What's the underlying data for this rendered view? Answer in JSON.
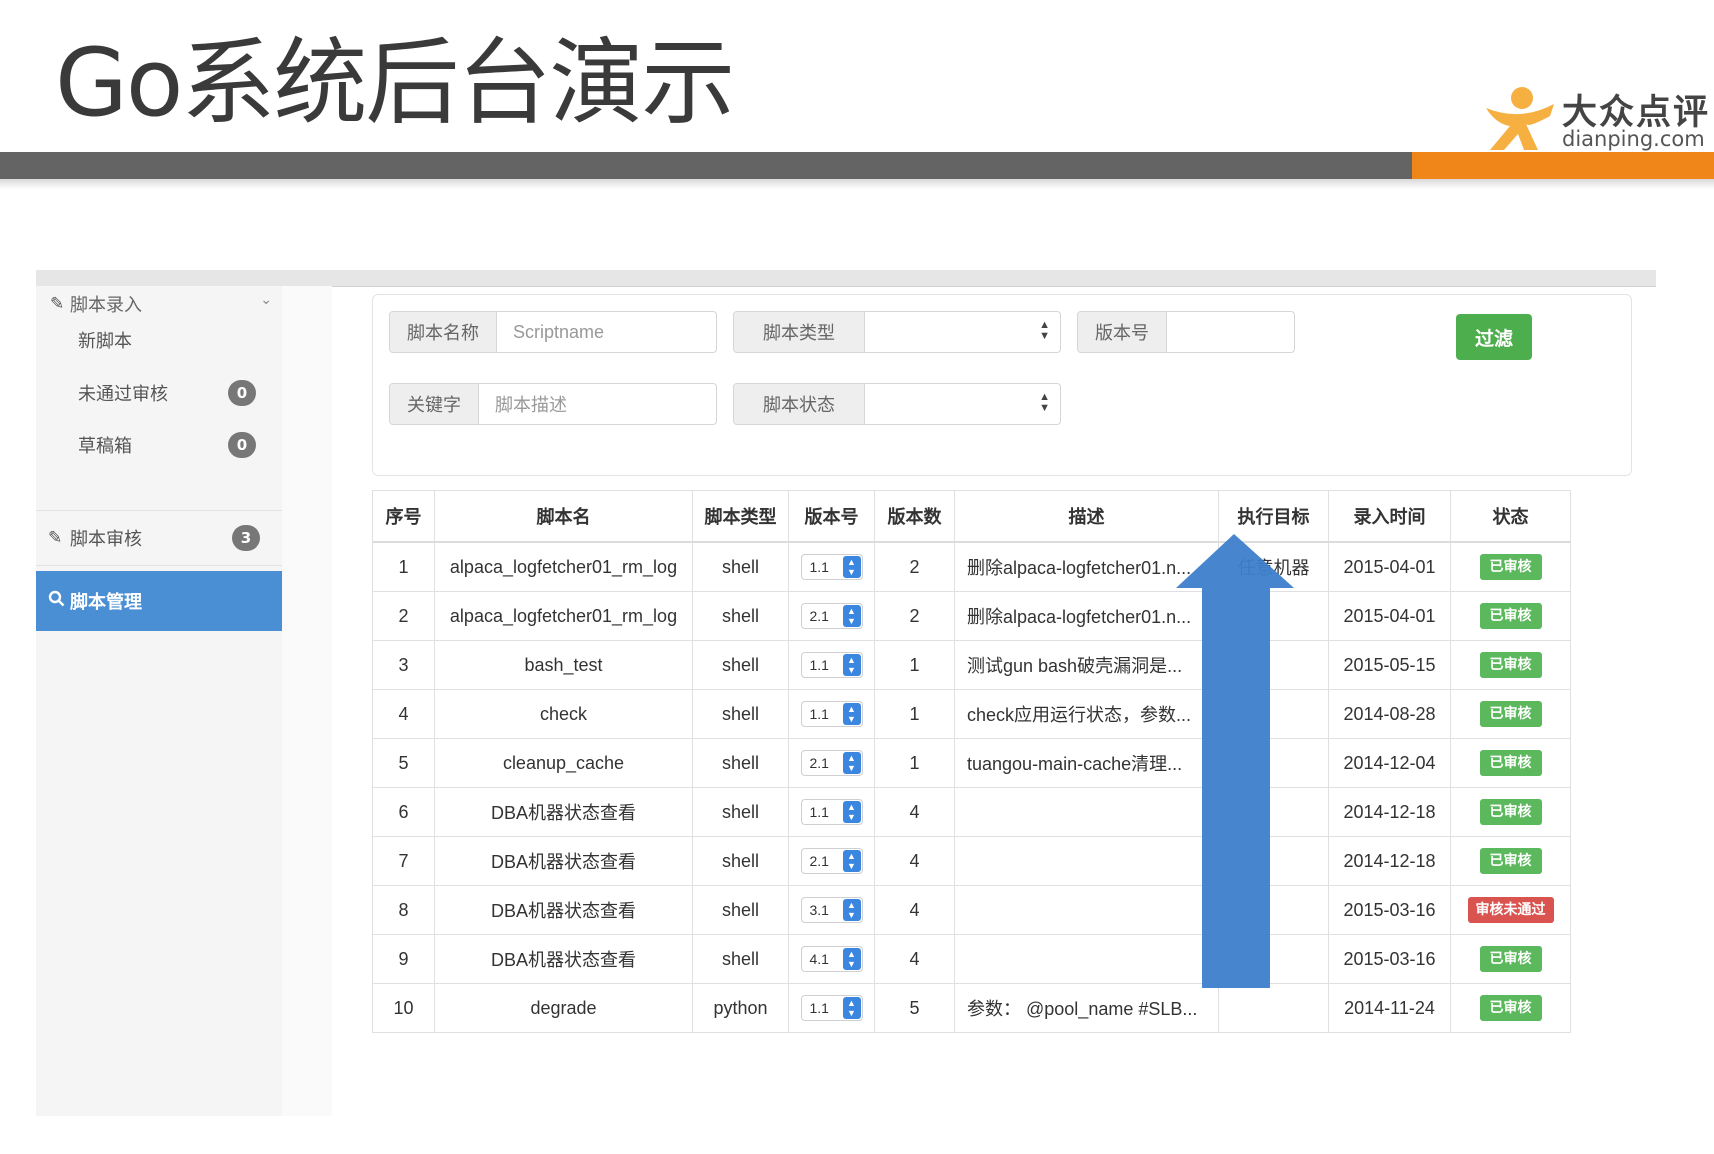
{
  "slide": {
    "title": "Go系统后台演示"
  },
  "logo": {
    "name_cn": "大众点评",
    "name_en": "dianping.com"
  },
  "sidebar": {
    "group": {
      "label": "脚本录入"
    },
    "sub_items": [
      {
        "label": "新脚本",
        "badge": ""
      },
      {
        "label": "未通过审核",
        "badge": "0"
      },
      {
        "label": "草稿箱",
        "badge": "0"
      }
    ],
    "review": {
      "label": "脚本审核",
      "badge": "3"
    },
    "manage": {
      "label": "脚本管理"
    }
  },
  "filters": {
    "script_name": {
      "label": "脚本名称",
      "placeholder": "Scriptname"
    },
    "script_type": {
      "label": "脚本类型",
      "value": ""
    },
    "version": {
      "label": "版本号",
      "value": ""
    },
    "keyword": {
      "label": "关键字",
      "placeholder": "脚本描述"
    },
    "script_status": {
      "label": "脚本状态",
      "value": ""
    },
    "filter_button": "过滤"
  },
  "table": {
    "headers": [
      "序号",
      "脚本名",
      "脚本类型",
      "版本号",
      "版本数",
      "描述",
      "执行目标",
      "录入时间",
      "状态"
    ],
    "rows": [
      {
        "id": "1",
        "name": "alpaca_logfetcher01_rm_log",
        "type": "shell",
        "version": "1.1",
        "count": "2",
        "desc": "删除alpaca-logfetcher01.n...",
        "target": "任意机器",
        "date": "2015-04-01",
        "status": "已审核"
      },
      {
        "id": "2",
        "name": "alpaca_logfetcher01_rm_log",
        "type": "shell",
        "version": "2.1",
        "count": "2",
        "desc": "删除alpaca-logfetcher01.n...",
        "target": "",
        "date": "2015-04-01",
        "status": "已审核"
      },
      {
        "id": "3",
        "name": "bash_test",
        "type": "shell",
        "version": "1.1",
        "count": "1",
        "desc": " 测试gun bash破壳漏洞是...",
        "target": "",
        "date": "2015-05-15",
        "status": "已审核"
      },
      {
        "id": "4",
        "name": "check",
        "type": "shell",
        "version": "1.1",
        "count": "1",
        "desc": "check应用运行状态，参数...",
        "target": "",
        "date": "2014-08-28",
        "status": "已审核"
      },
      {
        "id": "5",
        "name": "cleanup_cache",
        "type": "shell",
        "version": "2.1",
        "count": "1",
        "desc": " tuangou-main-cache清理...",
        "target": "",
        "date": "2014-12-04",
        "status": "已审核"
      },
      {
        "id": "6",
        "name": "DBA机器状态查看",
        "type": "shell",
        "version": "1.1",
        "count": "4",
        "desc": "",
        "target": "",
        "date": "2014-12-18",
        "status": "已审核"
      },
      {
        "id": "7",
        "name": "DBA机器状态查看",
        "type": "shell",
        "version": "2.1",
        "count": "4",
        "desc": "",
        "target": "",
        "date": "2014-12-18",
        "status": "已审核"
      },
      {
        "id": "8",
        "name": "DBA机器状态查看",
        "type": "shell",
        "version": "3.1",
        "count": "4",
        "desc": "",
        "target": "",
        "date": "2015-03-16",
        "status": "审核未通过"
      },
      {
        "id": "9",
        "name": "DBA机器状态查看",
        "type": "shell",
        "version": "4.1",
        "count": "4",
        "desc": "",
        "target": "",
        "date": "2015-03-16",
        "status": "已审核"
      },
      {
        "id": "10",
        "name": "degrade",
        "type": "python",
        "version": "1.1",
        "count": "5",
        "desc": "参数： @pool_name #SLB...",
        "target": "",
        "date": "2014-11-24",
        "status": "已审核"
      }
    ]
  },
  "colors": {
    "active_nav": "#4a8fd4",
    "approved": "#5cb85c",
    "rejected": "#d9534f",
    "filter_button": "#4cae4c",
    "arrow": "#3d7fcc",
    "band_orange": "#f08519"
  }
}
